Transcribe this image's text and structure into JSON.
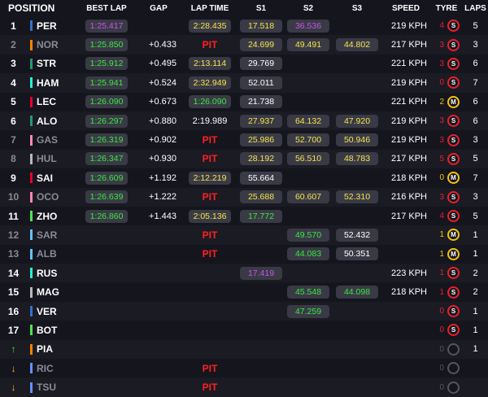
{
  "headers": {
    "position": "POSITION",
    "best_lap": "BEST LAP",
    "gap": "GAP",
    "lap_time": "LAP TIME",
    "s1": "S1",
    "s2": "S2",
    "s3": "S3",
    "speed": "SPEED",
    "tyre": "TYRE",
    "laps": "LAPS"
  },
  "colors": {
    "green": "#39e83f",
    "purple": "#c655e8",
    "yellow": "#f5e54a",
    "pit": "#ff2020",
    "soft_tyre": "#e8202a",
    "medium_tyre": "#f2c40c",
    "unknown_tyre": "#555560"
  },
  "rows": [
    {
      "pos": "1",
      "pos_icon": "",
      "code": "PER",
      "team": "#3671c6",
      "out": false,
      "best": "1:25.417",
      "best_c": "purple",
      "gap": "",
      "lap": "2:28.435",
      "lap_c": "yellow",
      "lap_t": "pill",
      "s1": "17.518",
      "s1_c": "yellow",
      "s2": "36.536",
      "s2_c": "purple",
      "s3": "",
      "s3_c": "",
      "speed": "219 KPH",
      "tyre_age": "4",
      "tyre": "S",
      "tyre_c": "soft",
      "laps": "5"
    },
    {
      "pos": "2",
      "pos_icon": "",
      "code": "NOR",
      "team": "#ff8000",
      "out": true,
      "best": "1:25.850",
      "best_c": "green",
      "gap": "+0.433",
      "lap": "PIT",
      "lap_c": "pit",
      "lap_t": "pit",
      "s1": "24.699",
      "s1_c": "yellow",
      "s2": "49.491",
      "s2_c": "yellow",
      "s3": "44.802",
      "s3_c": "yellow",
      "speed": "217 KPH",
      "tyre_age": "3",
      "tyre": "S",
      "tyre_c": "soft",
      "laps": "3"
    },
    {
      "pos": "3",
      "pos_icon": "",
      "code": "STR",
      "team": "#229971",
      "out": false,
      "best": "1:25.912",
      "best_c": "green",
      "gap": "+0.495",
      "lap": "2:13.114",
      "lap_c": "yellow",
      "lap_t": "pill",
      "s1": "29.769",
      "s1_c": "white",
      "s2": "",
      "s2_c": "",
      "s3": "",
      "s3_c": "",
      "speed": "221 KPH",
      "tyre_age": "3",
      "tyre": "S",
      "tyre_c": "soft",
      "laps": "6"
    },
    {
      "pos": "4",
      "pos_icon": "",
      "code": "HAM",
      "team": "#27f4d2",
      "out": false,
      "best": "1:25.941",
      "best_c": "green",
      "gap": "+0.524",
      "lap": "2:32.949",
      "lap_c": "yellow",
      "lap_t": "pill",
      "s1": "52.011",
      "s1_c": "white",
      "s2": "",
      "s2_c": "",
      "s3": "",
      "s3_c": "",
      "speed": "219 KPH",
      "tyre_age": "0",
      "tyre": "S",
      "tyre_c": "soft",
      "laps": "7"
    },
    {
      "pos": "5",
      "pos_icon": "",
      "code": "LEC",
      "team": "#e8002d",
      "out": false,
      "best": "1:26.090",
      "best_c": "green",
      "gap": "+0.673",
      "lap": "1:26.090",
      "lap_c": "green",
      "lap_t": "pill",
      "s1": "21.738",
      "s1_c": "white",
      "s2": "",
      "s2_c": "",
      "s3": "",
      "s3_c": "",
      "speed": "221 KPH",
      "tyre_age": "2",
      "tyre": "M",
      "tyre_c": "medium",
      "laps": "6"
    },
    {
      "pos": "6",
      "pos_icon": "",
      "code": "ALO",
      "team": "#229971",
      "out": false,
      "best": "1:26.297",
      "best_c": "green",
      "gap": "+0.880",
      "lap": "2:19.989",
      "lap_c": "white",
      "lap_t": "plain",
      "s1": "27.937",
      "s1_c": "yellow",
      "s2": "64.132",
      "s2_c": "yellow",
      "s3": "47.920",
      "s3_c": "yellow",
      "speed": "219 KPH",
      "tyre_age": "3",
      "tyre": "S",
      "tyre_c": "soft",
      "laps": "6"
    },
    {
      "pos": "7",
      "pos_icon": "",
      "code": "GAS",
      "team": "#ff87bc",
      "out": true,
      "best": "1:26.319",
      "best_c": "green",
      "gap": "+0.902",
      "lap": "PIT",
      "lap_c": "pit",
      "lap_t": "pit",
      "s1": "25.986",
      "s1_c": "yellow",
      "s2": "52.700",
      "s2_c": "yellow",
      "s3": "50.946",
      "s3_c": "yellow",
      "speed": "219 KPH",
      "tyre_age": "3",
      "tyre": "S",
      "tyre_c": "soft",
      "laps": "3"
    },
    {
      "pos": "8",
      "pos_icon": "",
      "code": "HUL",
      "team": "#b6babd",
      "out": true,
      "best": "1:26.347",
      "best_c": "green",
      "gap": "+0.930",
      "lap": "PIT",
      "lap_c": "pit",
      "lap_t": "pit",
      "s1": "28.192",
      "s1_c": "yellow",
      "s2": "56.510",
      "s2_c": "yellow",
      "s3": "48.783",
      "s3_c": "yellow",
      "speed": "217 KPH",
      "tyre_age": "5",
      "tyre": "S",
      "tyre_c": "soft",
      "laps": "5"
    },
    {
      "pos": "9",
      "pos_icon": "",
      "code": "SAI",
      "team": "#e8002d",
      "out": false,
      "best": "1:26.609",
      "best_c": "green",
      "gap": "+1.192",
      "lap": "2:12.219",
      "lap_c": "yellow",
      "lap_t": "pill",
      "s1": "55.664",
      "s1_c": "white",
      "s2": "",
      "s2_c": "",
      "s3": "",
      "s3_c": "",
      "speed": "218 KPH",
      "tyre_age": "0",
      "tyre": "M",
      "tyre_c": "medium",
      "laps": "7"
    },
    {
      "pos": "10",
      "pos_icon": "",
      "code": "OCO",
      "team": "#ff87bc",
      "out": true,
      "best": "1:26.639",
      "best_c": "green",
      "gap": "+1.222",
      "lap": "PIT",
      "lap_c": "pit",
      "lap_t": "pit",
      "s1": "25.688",
      "s1_c": "yellow",
      "s2": "60.607",
      "s2_c": "yellow",
      "s3": "52.310",
      "s3_c": "yellow",
      "speed": "216 KPH",
      "tyre_age": "3",
      "tyre": "S",
      "tyre_c": "soft",
      "laps": "3"
    },
    {
      "pos": "11",
      "pos_icon": "",
      "code": "ZHO",
      "team": "#52e252",
      "out": false,
      "best": "1:26.860",
      "best_c": "green",
      "gap": "+1.443",
      "lap": "2:05.136",
      "lap_c": "yellow",
      "lap_t": "pill",
      "s1": "17.772",
      "s1_c": "green",
      "s2": "",
      "s2_c": "",
      "s3": "",
      "s3_c": "",
      "speed": "217 KPH",
      "tyre_age": "4",
      "tyre": "S",
      "tyre_c": "soft",
      "laps": "5"
    },
    {
      "pos": "12",
      "pos_icon": "",
      "code": "SAR",
      "team": "#64c4ff",
      "out": true,
      "best": "",
      "best_c": "",
      "gap": "",
      "lap": "PIT",
      "lap_c": "pit",
      "lap_t": "pit",
      "s1": "",
      "s1_c": "",
      "s2": "49.570",
      "s2_c": "green",
      "s3": "52.432",
      "s3_c": "white",
      "speed": "",
      "tyre_age": "1",
      "tyre": "M",
      "tyre_c": "medium",
      "laps": "1"
    },
    {
      "pos": "13",
      "pos_icon": "",
      "code": "ALB",
      "team": "#64c4ff",
      "out": true,
      "best": "",
      "best_c": "",
      "gap": "",
      "lap": "PIT",
      "lap_c": "pit",
      "lap_t": "pit",
      "s1": "",
      "s1_c": "",
      "s2": "44.083",
      "s2_c": "green",
      "s3": "50.351",
      "s3_c": "white",
      "speed": "",
      "tyre_age": "1",
      "tyre": "M",
      "tyre_c": "medium",
      "laps": "1"
    },
    {
      "pos": "14",
      "pos_icon": "",
      "code": "RUS",
      "team": "#27f4d2",
      "out": false,
      "best": "",
      "best_c": "",
      "gap": "",
      "lap": "",
      "lap_c": "",
      "lap_t": "plain",
      "s1": "17.419",
      "s1_c": "purple",
      "s2": "",
      "s2_c": "",
      "s3": "",
      "s3_c": "",
      "speed": "223 KPH",
      "tyre_age": "1",
      "tyre": "S",
      "tyre_c": "soft",
      "laps": "2"
    },
    {
      "pos": "15",
      "pos_icon": "",
      "code": "MAG",
      "team": "#b6babd",
      "out": false,
      "best": "",
      "best_c": "",
      "gap": "",
      "lap": "",
      "lap_c": "",
      "lap_t": "plain",
      "s1": "",
      "s1_c": "",
      "s2": "45.548",
      "s2_c": "green",
      "s3": "44.098",
      "s3_c": "green",
      "speed": "218 KPH",
      "tyre_age": "1",
      "tyre": "S",
      "tyre_c": "soft",
      "laps": "2"
    },
    {
      "pos": "16",
      "pos_icon": "",
      "code": "VER",
      "team": "#3671c6",
      "out": false,
      "best": "",
      "best_c": "",
      "gap": "",
      "lap": "",
      "lap_c": "",
      "lap_t": "plain",
      "s1": "",
      "s1_c": "",
      "s2": "47.259",
      "s2_c": "green",
      "s3": "",
      "s3_c": "",
      "speed": "",
      "tyre_age": "0",
      "tyre": "S",
      "tyre_c": "soft",
      "laps": "1"
    },
    {
      "pos": "17",
      "pos_icon": "",
      "code": "BOT",
      "team": "#52e252",
      "out": false,
      "best": "",
      "best_c": "",
      "gap": "",
      "lap": "",
      "lap_c": "",
      "lap_t": "plain",
      "s1": "",
      "s1_c": "",
      "s2": "",
      "s2_c": "",
      "s3": "",
      "s3_c": "",
      "speed": "",
      "tyre_age": "0",
      "tyre": "S",
      "tyre_c": "soft",
      "laps": "1"
    },
    {
      "pos": "",
      "pos_icon": "up",
      "code": "PIA",
      "team": "#ff8000",
      "out": false,
      "best": "",
      "best_c": "",
      "gap": "",
      "lap": "",
      "lap_c": "",
      "lap_t": "plain",
      "s1": "",
      "s1_c": "",
      "s2": "",
      "s2_c": "",
      "s3": "",
      "s3_c": "",
      "speed": "",
      "tyre_age": "0",
      "tyre": "",
      "tyre_c": "unknown",
      "laps": "1"
    },
    {
      "pos": "",
      "pos_icon": "down",
      "code": "RIC",
      "team": "#6692ff",
      "out": true,
      "best": "",
      "best_c": "",
      "gap": "",
      "lap": "PIT",
      "lap_c": "pit",
      "lap_t": "pit",
      "s1": "",
      "s1_c": "",
      "s2": "",
      "s2_c": "",
      "s3": "",
      "s3_c": "",
      "speed": "",
      "tyre_age": "0",
      "tyre": "",
      "tyre_c": "unknown",
      "laps": ""
    },
    {
      "pos": "",
      "pos_icon": "down",
      "code": "TSU",
      "team": "#6692ff",
      "out": true,
      "best": "",
      "best_c": "",
      "gap": "",
      "lap": "PIT",
      "lap_c": "pit",
      "lap_t": "pit",
      "s1": "",
      "s1_c": "",
      "s2": "",
      "s2_c": "",
      "s3": "",
      "s3_c": "",
      "speed": "",
      "tyre_age": "0",
      "tyre": "",
      "tyre_c": "unknown",
      "laps": ""
    }
  ]
}
